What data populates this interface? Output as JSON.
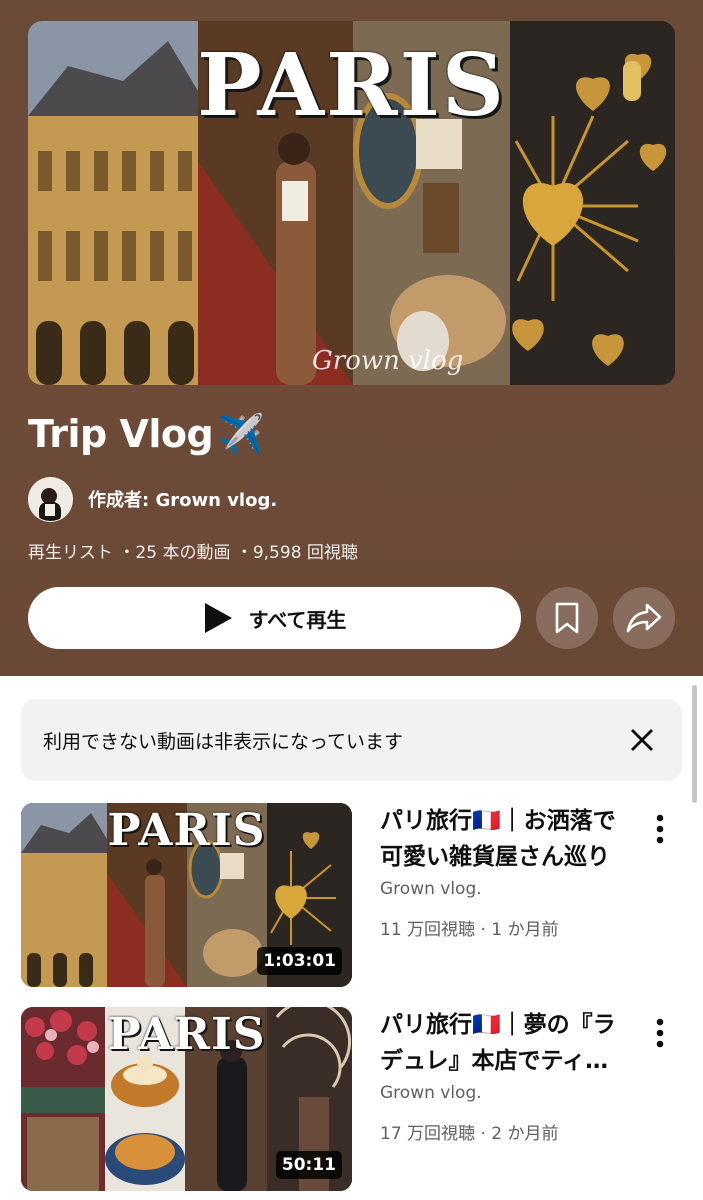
{
  "playlist": {
    "hero_title": "PARIS",
    "hero_watermark": "Grown vlog",
    "title": "Trip Vlog",
    "title_emoji": "✈️",
    "author": "作成者: Grown vlog.",
    "meta": "再生リスト ・25 本の動画 ・9,598 回視聴",
    "play_all_label": "すべて再生",
    "background_color": "#6b4a37"
  },
  "notice": {
    "text": "利用できない動画は非表示になっています"
  },
  "videos": [
    {
      "thumb_title": "PARIS",
      "title": "パリ旅行🇫🇷｜お洒落で可愛い雑貨屋さん巡り",
      "channel": "Grown vlog.",
      "stats": "11 万回視聴 · 1 か月前",
      "duration": "1:03:01"
    },
    {
      "thumb_title": "PARIS",
      "title": "パリ旅行🇫🇷｜夢の『ラデュレ』本店でティータイム",
      "channel": "Grown vlog.",
      "stats": "17 万回視聴 · 2 か月前",
      "duration": "50:11"
    }
  ],
  "icons": {
    "play": "play-icon",
    "save": "bookmark-icon",
    "share": "share-icon",
    "close": "close-icon",
    "more": "more-vert-icon"
  }
}
